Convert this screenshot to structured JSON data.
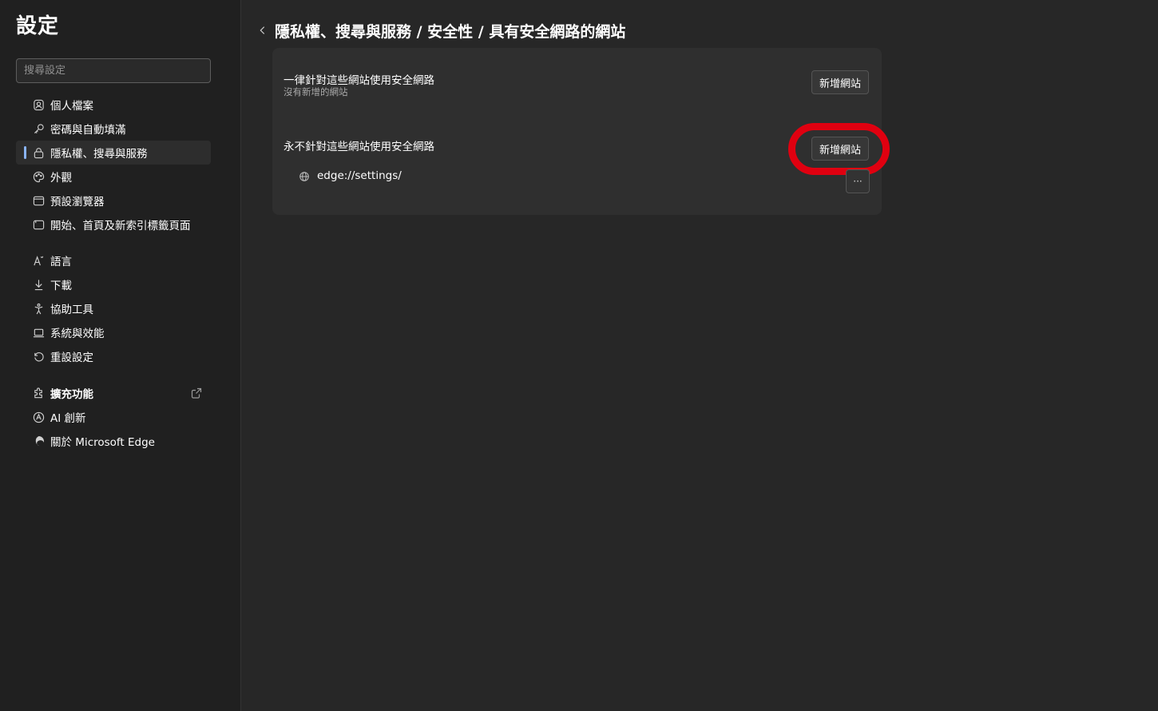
{
  "sidebar": {
    "title": "設定",
    "search_placeholder": "搜尋設定",
    "items": [
      {
        "label": "個人檔案",
        "icon": "profile-icon"
      },
      {
        "label": "密碼與自動填滿",
        "icon": "key-icon"
      },
      {
        "label": "隱私權、搜尋與服務",
        "icon": "lock-icon",
        "active": true
      },
      {
        "label": "外觀",
        "icon": "palette-icon"
      },
      {
        "label": "預設瀏覽器",
        "icon": "browser-icon"
      },
      {
        "label": "開始、首頁及新索引標籤頁面",
        "icon": "home-page-icon"
      },
      {
        "label": "語言",
        "icon": "language-icon"
      },
      {
        "label": "下載",
        "icon": "download-icon"
      },
      {
        "label": "協助工具",
        "icon": "accessibility-icon"
      },
      {
        "label": "系統與效能",
        "icon": "laptop-icon"
      },
      {
        "label": "重設設定",
        "icon": "reset-icon"
      },
      {
        "label": "擴充功能",
        "icon": "puzzle-icon",
        "external": true
      },
      {
        "label": "AI 創新",
        "icon": "ai-icon"
      },
      {
        "label": "關於 Microsoft Edge",
        "icon": "edge-logo-icon"
      }
    ]
  },
  "header": {
    "breadcrumb": "隱私權、搜尋與服務 / 安全性 / 具有安全網路的網站"
  },
  "always": {
    "title": "一律針對這些網站使用安全網路",
    "subtitle": "沒有新增的網站",
    "add_button": "新增網站"
  },
  "never": {
    "title": "永不針對這些網站使用安全網路",
    "add_button": "新增網站",
    "sites": [
      "edge://settings/"
    ],
    "more_button": "···"
  },
  "colors": {
    "page_bg": "#272727",
    "sidebar_bg": "#202020",
    "card_bg": "#2f2f2f",
    "highlight": "#e00010",
    "accent": "#8ab4f8"
  }
}
